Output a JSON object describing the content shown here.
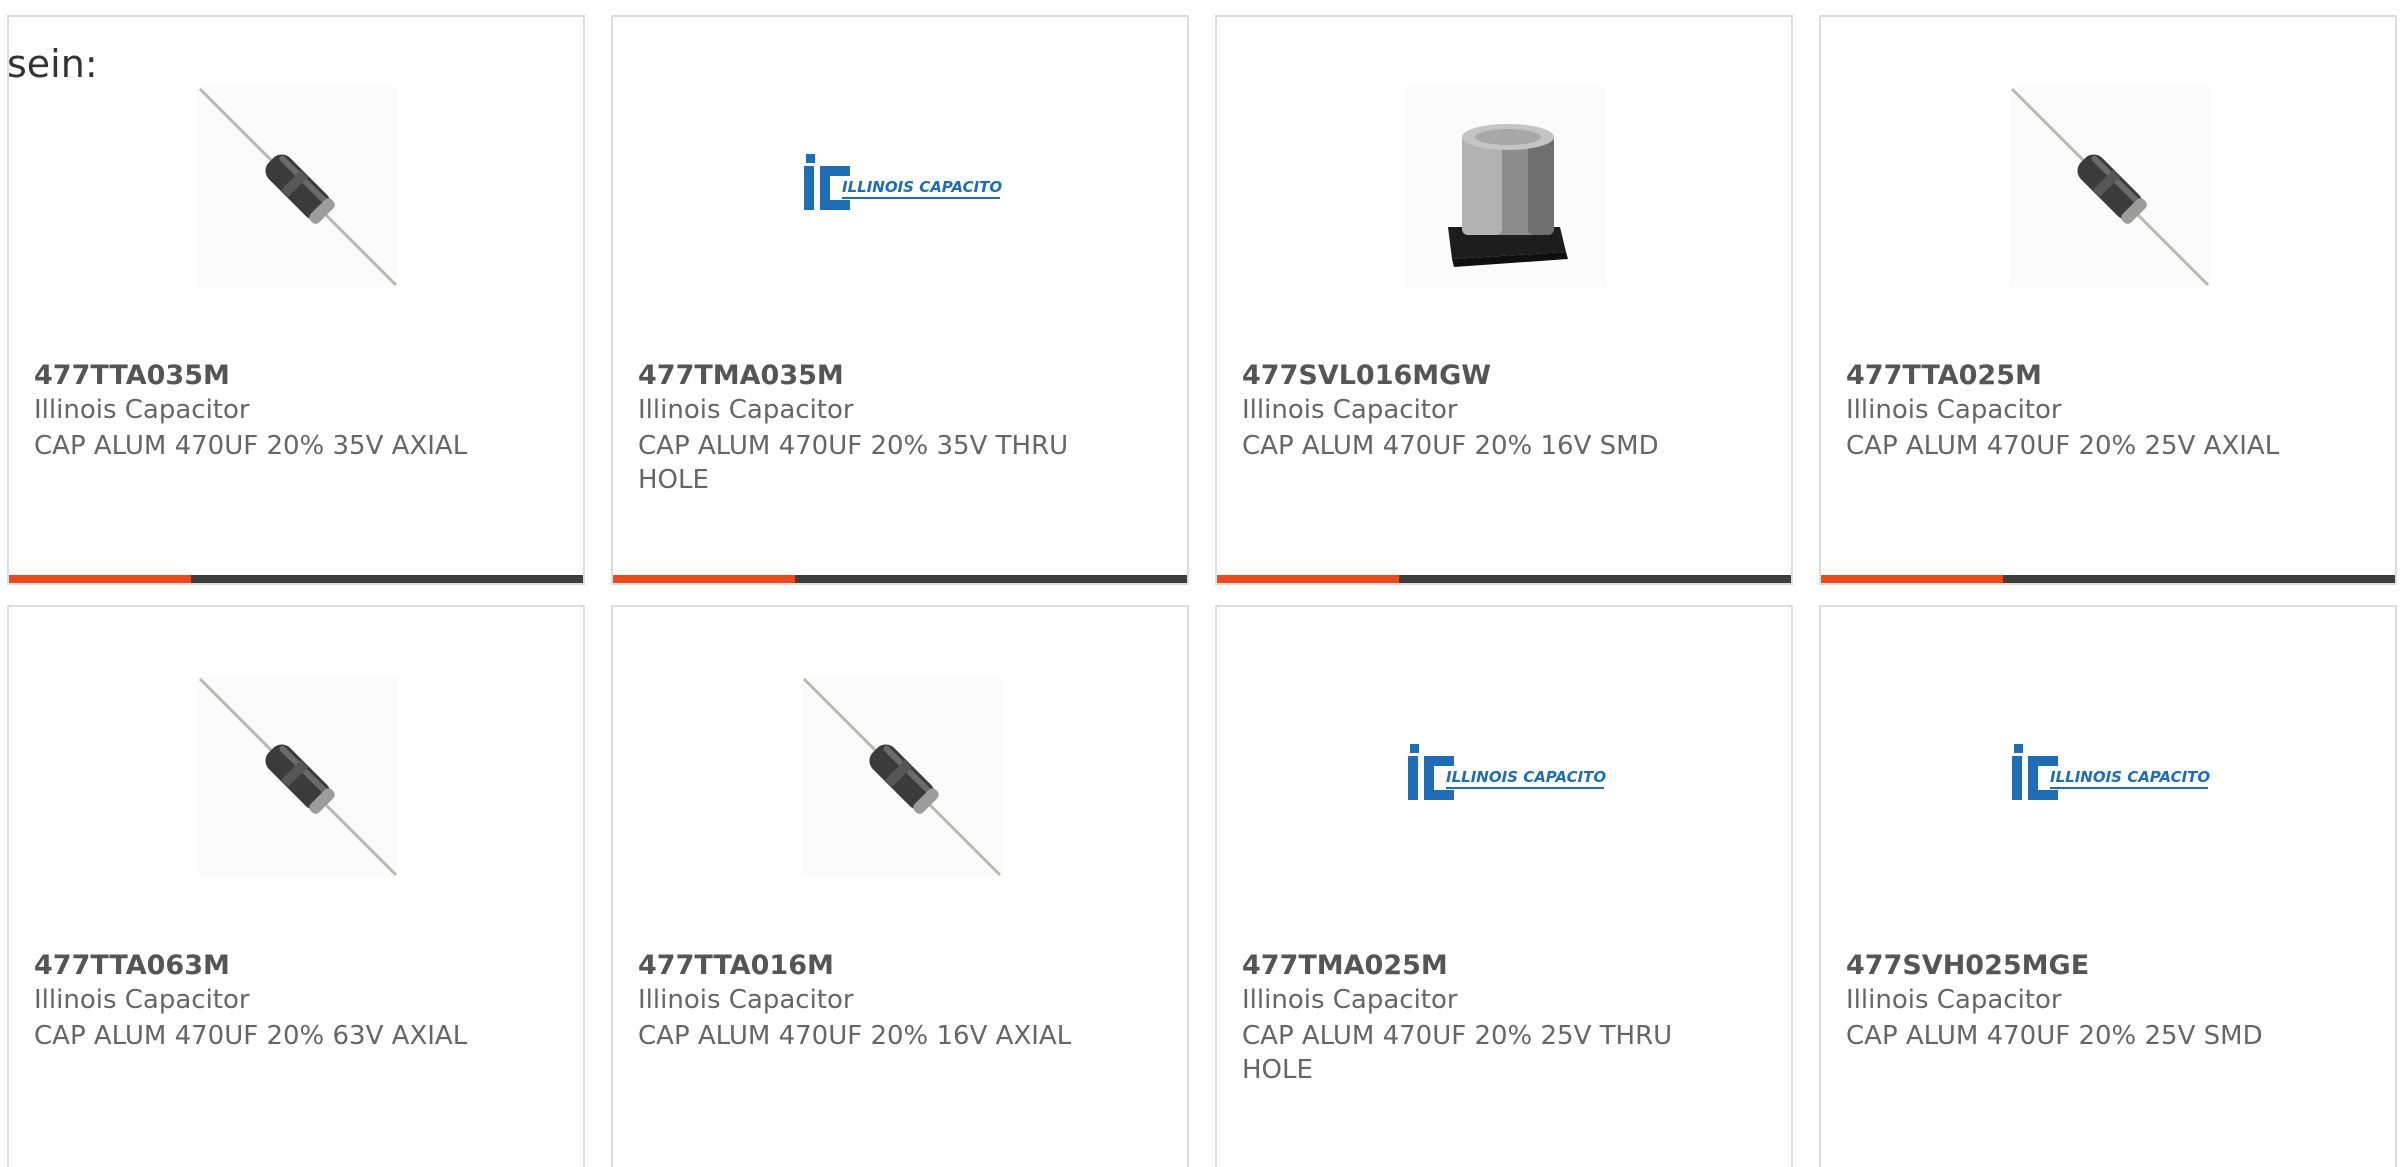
{
  "intro_text": "sein:",
  "colors": {
    "accent": "#e84a1c",
    "bar": "#3d3d3d",
    "logo_blue": "#1f6db5"
  },
  "products": [
    {
      "part": "477TTA035M",
      "manufacturer": "Illinois Capacitor",
      "description": "CAP ALUM 470UF 20% 35V AXIAL",
      "image": "axial-capacitor-image"
    },
    {
      "part": "477TMA035M",
      "manufacturer": "Illinois Capacitor",
      "description": "CAP ALUM 470UF 20% 35V THRU HOLE",
      "image": "illinois-capacitor-logo",
      "logo_text": "ILLINOIS CAPACITOR, INC."
    },
    {
      "part": "477SVL016MGW",
      "manufacturer": "Illinois Capacitor",
      "description": "CAP ALUM 470UF 20% 16V SMD",
      "image": "smd-capacitor-image"
    },
    {
      "part": "477TTA025M",
      "manufacturer": "Illinois Capacitor",
      "description": "CAP ALUM 470UF 20% 25V AXIAL",
      "image": "axial-capacitor-image"
    },
    {
      "part": "477TTA063M",
      "manufacturer": "Illinois Capacitor",
      "description": "CAP ALUM 470UF 20% 63V AXIAL",
      "image": "axial-capacitor-image"
    },
    {
      "part": "477TTA016M",
      "manufacturer": "Illinois Capacitor",
      "description": "CAP ALUM 470UF 20% 16V AXIAL",
      "image": "axial-capacitor-image"
    },
    {
      "part": "477TMA025M",
      "manufacturer": "Illinois Capacitor",
      "description": "CAP ALUM 470UF 20% 25V THRU HOLE",
      "image": "illinois-capacitor-logo",
      "logo_text": "ILLINOIS CAPACITOR, INC."
    },
    {
      "part": "477SVH025MGE",
      "manufacturer": "Illinois Capacitor",
      "description": "CAP ALUM 470UF 20% 25V SMD",
      "image": "illinois-capacitor-logo",
      "logo_text": "ILLINOIS CAPACITOR, INC."
    }
  ]
}
